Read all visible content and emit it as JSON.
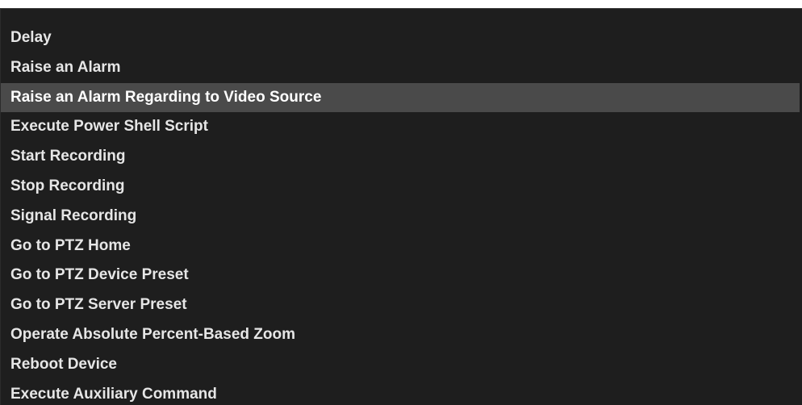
{
  "action_list": {
    "selected_index": 2,
    "items": [
      {
        "label": "Delay"
      },
      {
        "label": "Raise an Alarm"
      },
      {
        "label": "Raise an Alarm Regarding to Video Source"
      },
      {
        "label": "Execute Power Shell Script"
      },
      {
        "label": "Start Recording"
      },
      {
        "label": "Stop Recording"
      },
      {
        "label": "Signal Recording"
      },
      {
        "label": "Go to PTZ Home"
      },
      {
        "label": "Go to PTZ Device Preset"
      },
      {
        "label": "Go to PTZ Server Preset"
      },
      {
        "label": "Operate Absolute Percent-Based Zoom"
      },
      {
        "label": "Reboot Device"
      },
      {
        "label": "Execute Auxiliary Command"
      }
    ]
  },
  "colors": {
    "panel_background": "#1e1e1e",
    "selected_background": "#4a4a4a",
    "text": "#e6e6e6"
  }
}
